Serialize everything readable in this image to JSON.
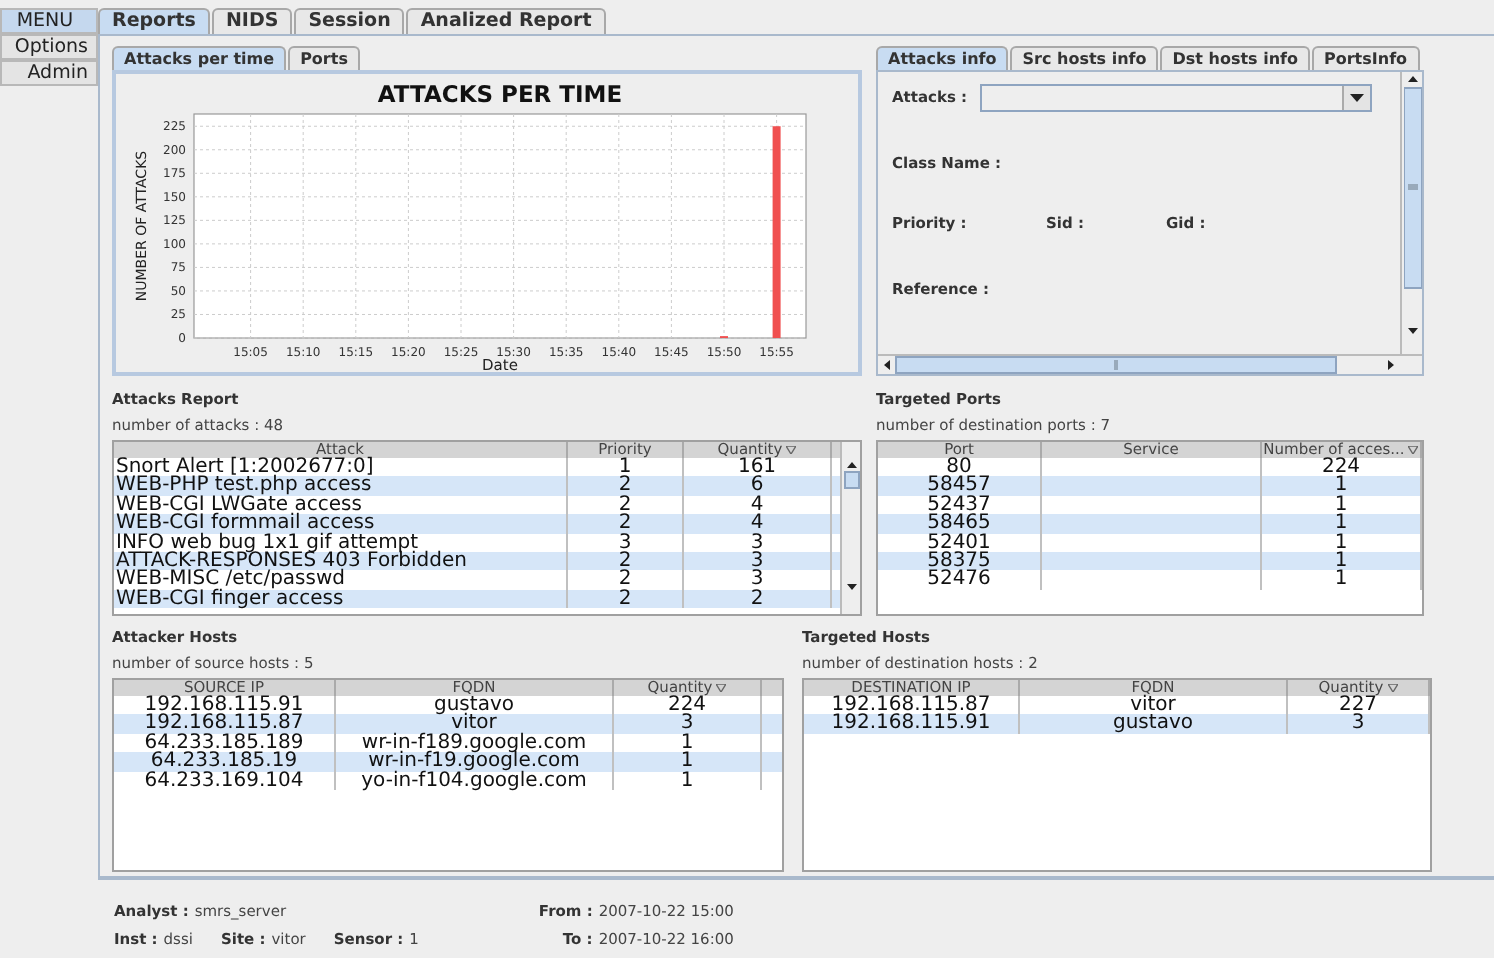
{
  "menu": [
    {
      "label": "MENU",
      "selected": true
    },
    {
      "label": "Options",
      "selected": false
    },
    {
      "label": "Admin",
      "selected": false
    }
  ],
  "tabs": [
    {
      "label": "Reports",
      "selected": true
    },
    {
      "label": "NIDS",
      "selected": false
    },
    {
      "label": "Session",
      "selected": false
    },
    {
      "label": "Analized Report",
      "selected": false
    }
  ],
  "chart_tabs": [
    {
      "label": "Attacks per time",
      "selected": true
    },
    {
      "label": "Ports",
      "selected": false
    }
  ],
  "chart": {
    "chart_data": {
      "type": "bar",
      "title": "ATTACKS PER TIME",
      "xlabel": "Date",
      "ylabel": "NUMBER OF ATTACKS",
      "categories": [
        "15:05",
        "15:10",
        "15:15",
        "15:20",
        "15:25",
        "15:30",
        "15:35",
        "15:40",
        "15:45",
        "15:50",
        "15:55"
      ],
      "series": [
        {
          "color": "#f05050",
          "values": [
            null,
            null,
            null,
            null,
            null,
            null,
            null,
            null,
            null,
            2,
            225
          ]
        }
      ],
      "ylim": [
        0,
        238
      ],
      "grid": true,
      "yticks": [
        0,
        25,
        50,
        75,
        100,
        125,
        150,
        175,
        200,
        225
      ]
    }
  },
  "info_tabs": [
    {
      "label": "Attacks info",
      "selected": true
    },
    {
      "label": "Src hosts info",
      "selected": false
    },
    {
      "label": "Dst hosts info",
      "selected": false
    },
    {
      "label": "PortsInfo",
      "selected": false
    }
  ],
  "info": {
    "attacks_label": "Attacks :",
    "class_name": "Class Name :",
    "priority": "Priority :",
    "sid": "Sid :",
    "gid": "Gid :",
    "reference": "Reference :"
  },
  "attacks_report": {
    "title": "Attacks Report",
    "count": "number of attacks : 48",
    "columns": [
      {
        "label": "Attack",
        "sorted": false
      },
      {
        "label": "Priority",
        "sorted": false
      },
      {
        "label": "Quantity",
        "sorted": true
      }
    ],
    "rows": [
      [
        "Snort Alert [1:2002677:0]",
        "1",
        "161"
      ],
      [
        "WEB-PHP test.php access",
        "2",
        "6"
      ],
      [
        "WEB-CGI LWGate access",
        "2",
        "4"
      ],
      [
        "WEB-CGI formmail access",
        "2",
        "4"
      ],
      [
        "INFO web bug 1x1 gif attempt",
        "3",
        "3"
      ],
      [
        "ATTACK-RESPONSES 403 Forbidden",
        "2",
        "3"
      ],
      [
        "WEB-MISC /etc/passwd",
        "2",
        "3"
      ],
      [
        "WEB-CGI finger access",
        "2",
        "2"
      ]
    ]
  },
  "targeted_ports": {
    "title": "Targeted Ports",
    "count": "number of destination ports : 7",
    "columns": [
      {
        "label": "Port",
        "sorted": false
      },
      {
        "label": "Service",
        "sorted": false
      },
      {
        "label": "Number of acces...",
        "sorted": true
      }
    ],
    "rows": [
      [
        "80",
        "",
        "224"
      ],
      [
        "58457",
        "",
        "1"
      ],
      [
        "52437",
        "",
        "1"
      ],
      [
        "58465",
        "",
        "1"
      ],
      [
        "52401",
        "",
        "1"
      ],
      [
        "58375",
        "",
        "1"
      ],
      [
        "52476",
        "",
        "1"
      ]
    ]
  },
  "attacker_hosts": {
    "title": "Attacker Hosts",
    "count": "number of source hosts : 5",
    "columns": [
      {
        "label": "SOURCE IP",
        "sorted": false
      },
      {
        "label": "FQDN",
        "sorted": false
      },
      {
        "label": "Quantity",
        "sorted": true
      }
    ],
    "rows": [
      [
        "192.168.115.91",
        "gustavo",
        "224"
      ],
      [
        "192.168.115.87",
        "vitor",
        "3"
      ],
      [
        "64.233.185.189",
        "wr-in-f189.google.com",
        "1"
      ],
      [
        "64.233.185.19",
        "wr-in-f19.google.com",
        "1"
      ],
      [
        "64.233.169.104",
        "yo-in-f104.google.com",
        "1"
      ]
    ]
  },
  "targeted_hosts": {
    "title": "Targeted Hosts",
    "count": "number of destination hosts : 2",
    "columns": [
      {
        "label": "DESTINATION IP",
        "sorted": false
      },
      {
        "label": "FQDN",
        "sorted": false
      },
      {
        "label": "Quantity",
        "sorted": true
      }
    ],
    "rows": [
      [
        "192.168.115.87",
        "vitor",
        "227"
      ],
      [
        "192.168.115.91",
        "gustavo",
        "3"
      ]
    ]
  },
  "footer": {
    "analyst": {
      "label": "Analyst :",
      "value": "smrs_server"
    },
    "inst": {
      "label": "Inst :",
      "value": "dssi"
    },
    "site": {
      "label": "Site :",
      "value": "vitor"
    },
    "sensor": {
      "label": "Sensor :",
      "value": "1"
    },
    "from": {
      "label": "From :",
      "value": "2007-10-22 15:00"
    },
    "to": {
      "label": "To :",
      "value": "2007-10-22 16:00"
    }
  }
}
